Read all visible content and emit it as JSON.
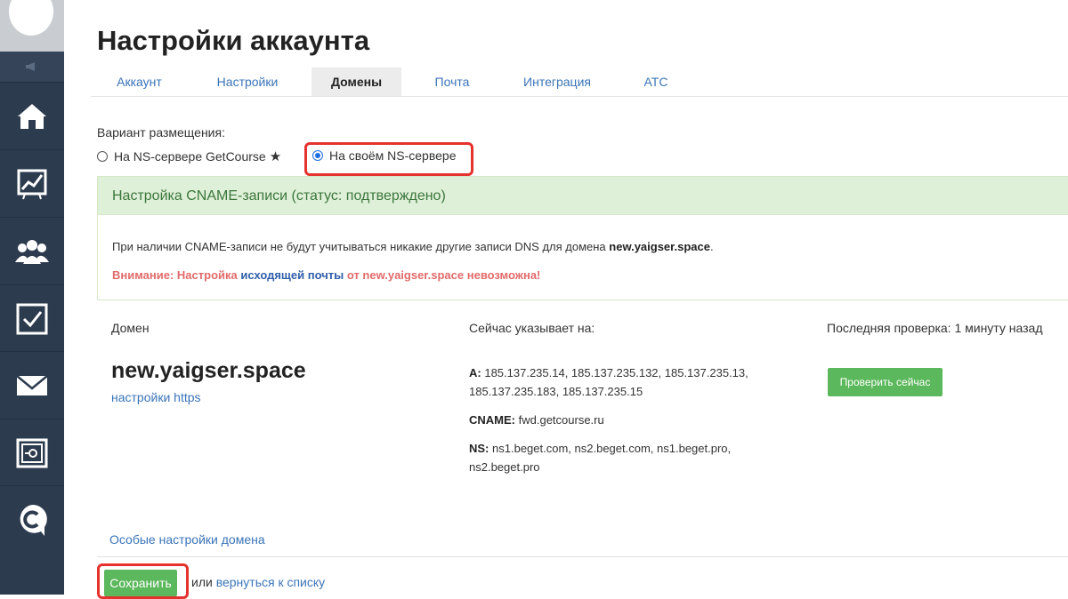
{
  "page": {
    "title": "Настройки аккаунта"
  },
  "tabs": [
    {
      "label": "Аккаунт"
    },
    {
      "label": "Настройки"
    },
    {
      "label": "Домены",
      "active": true
    },
    {
      "label": "Почта"
    },
    {
      "label": "Интеграция"
    },
    {
      "label": "АТС"
    }
  ],
  "placement": {
    "label": "Вариант размещения:",
    "options": [
      {
        "label": "На NS-сервере GetCourse",
        "suffix": "★",
        "selected": false
      },
      {
        "label": "На своём NS-сервере",
        "selected": true
      }
    ]
  },
  "cname": {
    "header": "Настройка CNAME-записи (статус: подтверждено)",
    "info_prefix": "При наличии CNAME-записи не будут учитываться никакие другие записи DNS для домена ",
    "info_domain": "new.yaigser.space",
    "info_suffix": ".",
    "warn_prefix": "Внимание: Настройка ",
    "warn_link": "исходящей почты",
    "warn_suffix": " от new.yaigser.space невозможна!"
  },
  "domain_table": {
    "col_domain": "Домен",
    "col_points": "Сейчас указывает на:",
    "col_check": "Последняя проверка: 1 минуту назад",
    "domain": "new.yaigser.space",
    "https_link": "настройки https",
    "records": [
      {
        "type": "A:",
        "value": "185.137.235.14, 185.137.235.132, 185.137.235.13, 185.137.235.183, 185.137.235.15"
      },
      {
        "type": "CNAME:",
        "value": "fwd.getcourse.ru"
      },
      {
        "type": "NS:",
        "value": "ns1.beget.com, ns2.beget.com, ns1.beget.pro, ns2.beget.pro"
      }
    ],
    "check_button": "Проверить сейчас"
  },
  "special_settings_link": "Особые настройки домена",
  "footer": {
    "save_button": "Сохранить",
    "or_text": "или",
    "back_link": "вернуться к списку"
  },
  "colors": {
    "sidebar": "#2d3b4e",
    "accent_link": "#3a74b8",
    "success": "#5cb85c",
    "highlight": "#e5322d"
  },
  "sidebar_icons": [
    "megaphone-icon",
    "home-icon",
    "chart-icon",
    "users-icon",
    "checkbox-icon",
    "mail-icon",
    "safe-icon",
    "getcourse-logo-icon"
  ]
}
